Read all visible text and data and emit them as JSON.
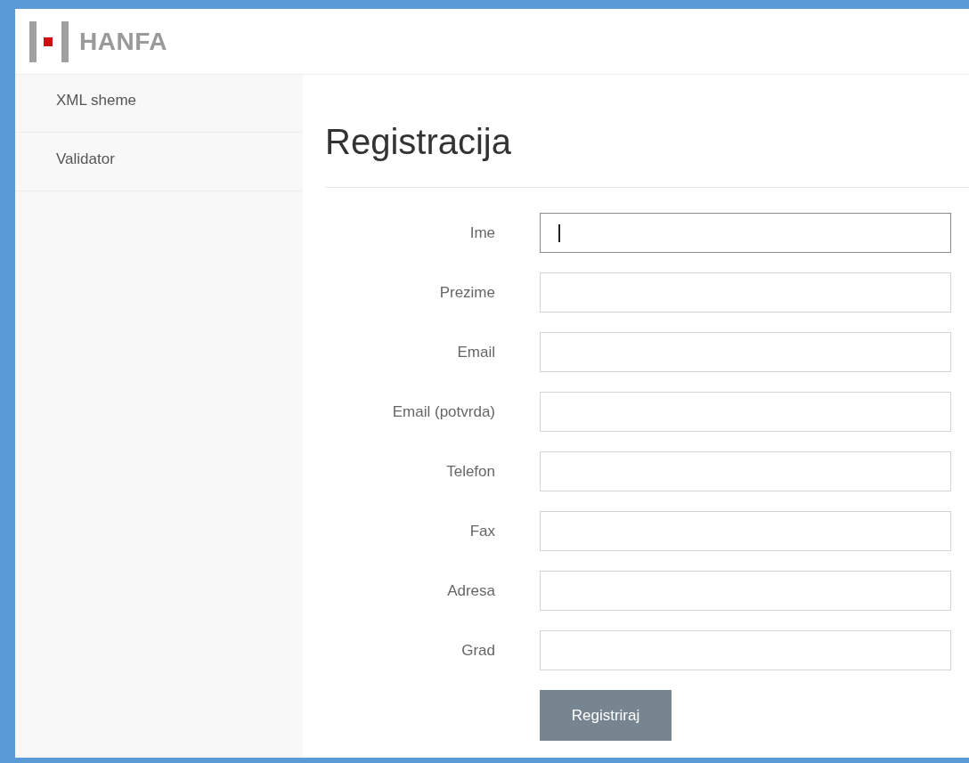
{
  "header": {
    "logo_text": "HANFA"
  },
  "sidebar": {
    "items": [
      {
        "label": "XML sheme"
      },
      {
        "label": "Validator"
      }
    ]
  },
  "page": {
    "title": "Registracija"
  },
  "form": {
    "fields": [
      {
        "label": "Ime",
        "focused": true
      },
      {
        "label": "Prezime",
        "focused": false
      },
      {
        "label": "Email",
        "focused": false
      },
      {
        "label": "Email (potvrda)",
        "focused": false
      },
      {
        "label": "Telefon",
        "focused": false
      },
      {
        "label": "Fax",
        "focused": false
      },
      {
        "label": "Adresa",
        "focused": false
      },
      {
        "label": "Grad",
        "focused": false
      }
    ],
    "submit": "Registriraj"
  }
}
